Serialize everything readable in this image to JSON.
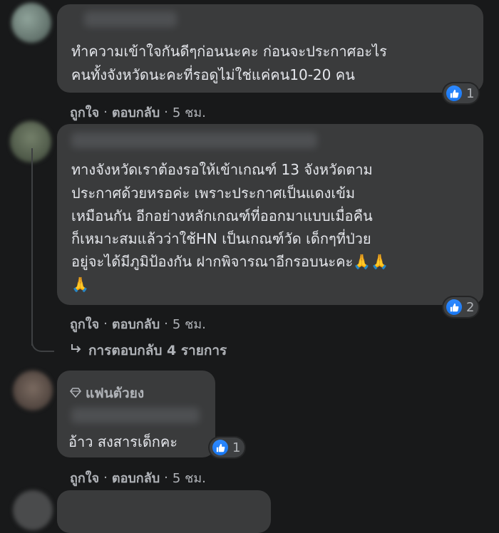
{
  "comments": [
    {
      "lines": [
        "ทำความเข้าใจกันดีๆก่อนนะคะ ก่อนจะประกาศอะไร",
        "คนทั้งจังหวัดนะคะที่รอดูไม่ใช่แค่คน10-20 คน"
      ],
      "reaction_count": "1",
      "like_label": "ถูกใจ",
      "reply_label": "ตอบกลับ",
      "time": "5 ชม."
    },
    {
      "lines": [
        "ทางจังหวัดเราต้องรอให้เข้าเกณฑ์ 13 จังหวัดตาม",
        "ประกาศด้วยหรอค่ะ เพราะประกาศเป็นแดงเข้ม",
        "เหมือนกัน อีกอย่างหลักเกณฑ์ที่ออกมาแบบเมื่อคืน",
        "ก็เหมาะสมแล้วว่าใช้HN เป็นเกณฑ์วัด เด็กๆที่ป่วย",
        "อยู่จะได้มีภูมิป้องกัน ฝากพิจารณาอีกรอบนะคะ🙏🙏",
        "🙏"
      ],
      "reaction_count": "2",
      "like_label": "ถูกใจ",
      "reply_label": "ตอบกลับ",
      "time": "5 ชม.",
      "replies_label": "การตอบกลับ 4 รายการ"
    },
    {
      "badge": "แฟนตัวยง",
      "lines": [
        "อ้าว สงสารเด็กคะ"
      ],
      "reaction_count": "1",
      "like_label": "ถูกใจ",
      "reply_label": "ตอบกลับ",
      "time": "5 ชม."
    }
  ],
  "separator": "·",
  "colors": {
    "background": "#18191a",
    "bubble": "#3a3b3c",
    "text": "#e4e6eb",
    "secondary": "#b0b3b8",
    "like_blue": "#1877f2"
  },
  "icons": {
    "like": "thumbs-up-icon",
    "reply_arrow": "reply-arrow-icon",
    "badge": "diamond-icon"
  }
}
